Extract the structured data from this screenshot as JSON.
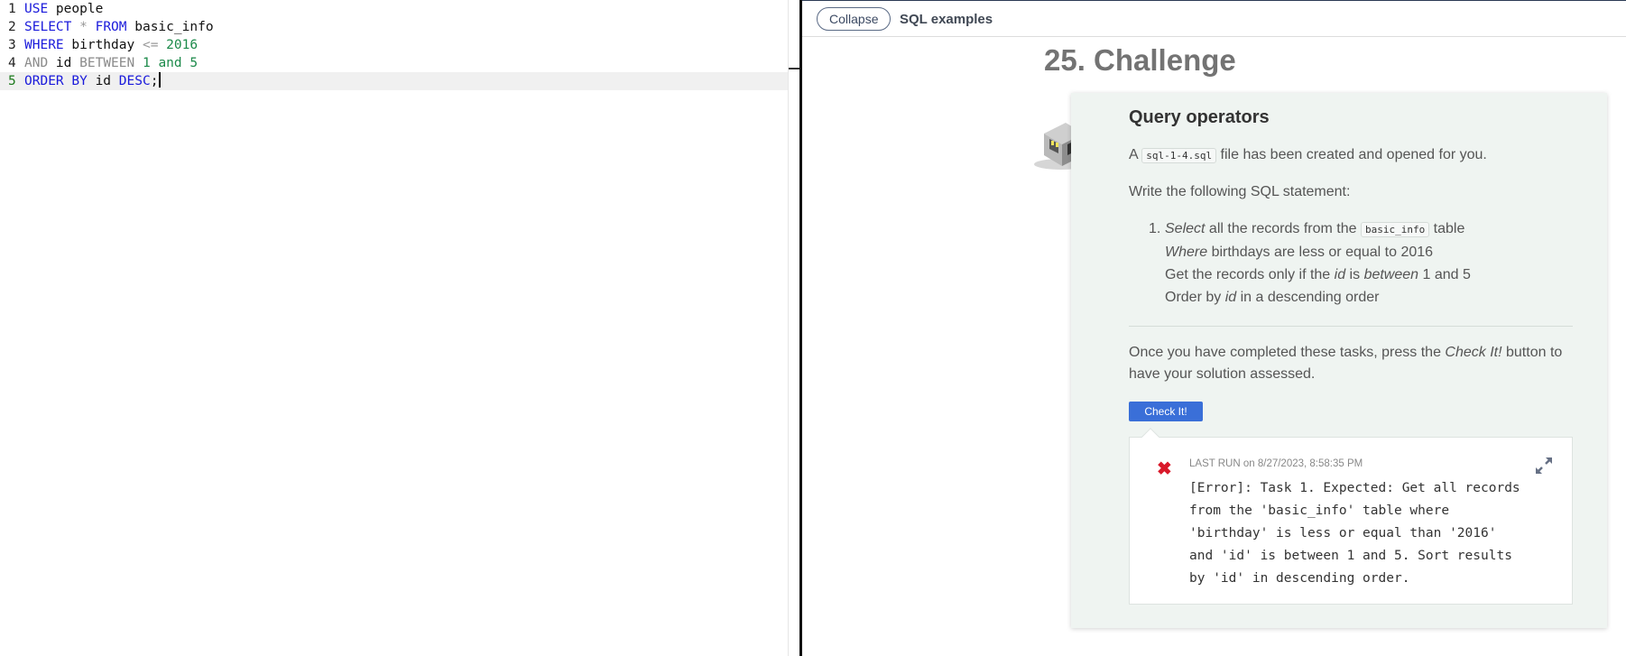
{
  "editor": {
    "lines": [
      {
        "num": "1",
        "tokens": [
          {
            "t": "USE",
            "c": "kw"
          },
          {
            "t": " people",
            "c": "id"
          }
        ]
      },
      {
        "num": "2",
        "tokens": [
          {
            "t": "SELECT",
            "c": "kw"
          },
          {
            "t": " * ",
            "c": "op"
          },
          {
            "t": "FROM",
            "c": "kw"
          },
          {
            "t": " basic_info",
            "c": "id"
          }
        ]
      },
      {
        "num": "3",
        "tokens": [
          {
            "t": "WHERE",
            "c": "kw"
          },
          {
            "t": " birthday ",
            "c": "id"
          },
          {
            "t": "<=",
            "c": "op"
          },
          {
            "t": " 2016",
            "c": "num"
          }
        ]
      },
      {
        "num": "4",
        "tokens": [
          {
            "t": "AND",
            "c": "dim"
          },
          {
            "t": " id ",
            "c": "id"
          },
          {
            "t": "BETWEEN",
            "c": "dim"
          },
          {
            "t": " 1 ",
            "c": "num"
          },
          {
            "t": "and",
            "c": "num"
          },
          {
            "t": " 5",
            "c": "num"
          }
        ]
      },
      {
        "num": "5",
        "tokens": [
          {
            "t": "ORDER BY",
            "c": "kw"
          },
          {
            "t": " id ",
            "c": "id"
          },
          {
            "t": "DESC",
            "c": "kw"
          },
          {
            "t": ";",
            "c": "id"
          }
        ],
        "active": true
      }
    ]
  },
  "topbar": {
    "collapse_label": "Collapse",
    "title": "SQL examples"
  },
  "challenge": {
    "page_title": "25. Challenge",
    "heading": "Query operators",
    "intro_prefix": "A ",
    "intro_file": "sql-1-4.sql",
    "intro_suffix": " file has been created and opened for you.",
    "instruction": "Write the following SQL statement:",
    "task_number": "1.",
    "task_line1_em": "Select",
    "task_line1_mid": " all the records from the ",
    "task_line1_code": "basic_info",
    "task_line1_end": " table",
    "task_line2_em": "Where",
    "task_line2_rest": " birthdays are less or equal to 2016",
    "task_line3_a": "Get the records only if the ",
    "task_line3_em1": "id",
    "task_line3_b": " is ",
    "task_line3_em2": "between",
    "task_line3_c": " 1 and 5",
    "task_line4_a": "Order by ",
    "task_line4_em": "id",
    "task_line4_b": " in a descending order",
    "completion_a": "Once you have completed these tasks, press the ",
    "completion_em": "Check It!",
    "completion_b": " button to have your solution assessed.",
    "check_button": "Check It!",
    "result": {
      "last_run_label": "Last run",
      "last_run_on": " on 8/27/2023, 8:58:35 PM",
      "status_icon": "error-x-icon",
      "message": "[Error]: Task 1. Expected: Get all records from the 'basic_info' table where 'birthday' is less or equal than '2016' and 'id' is between 1 and 5. Sort results by 'id' in descending order."
    }
  },
  "colors": {
    "keyword": "#1a1adb",
    "number": "#1c8a4a",
    "check_button": "#3a6fd8",
    "error": "#d9192a",
    "card_bg": "#eff4f1"
  }
}
